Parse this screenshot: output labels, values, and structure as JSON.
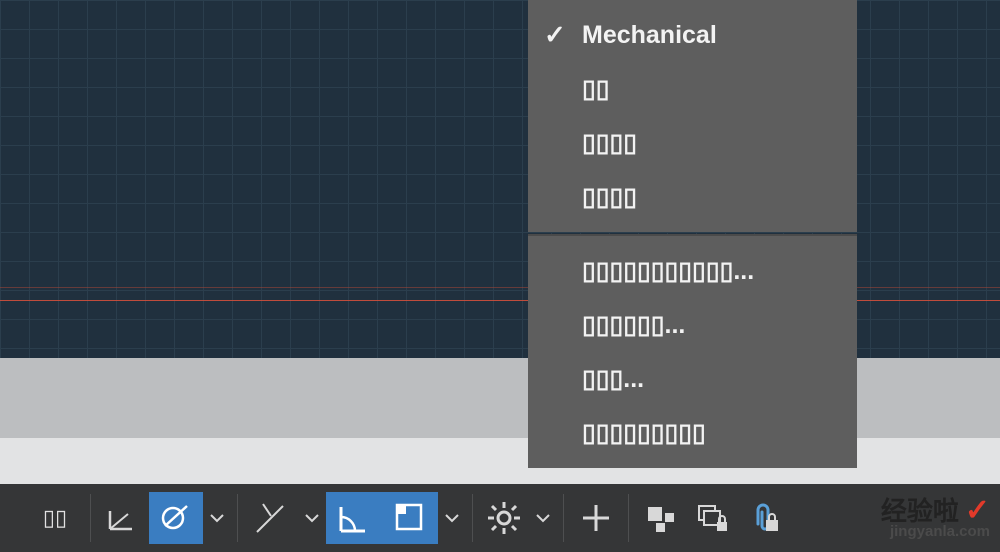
{
  "menu": {
    "block1": [
      {
        "label": "Mechanical",
        "checked": true
      },
      {
        "label": "▯▯",
        "checked": false
      },
      {
        "label": "▯▯▯▯",
        "checked": false
      },
      {
        "label": "▯▯▯▯",
        "checked": false
      }
    ],
    "block2": [
      {
        "label": "▯▯▯▯▯▯▯▯▯▯▯..."
      },
      {
        "label": "▯▯▯▯▯▯..."
      },
      {
        "label": "▯▯▯..."
      },
      {
        "label": "▯▯▯▯▯▯▯▯▯"
      }
    ]
  },
  "statusbar": {
    "model_label": "▯▯",
    "buttons": {
      "snap": {
        "active": false,
        "icon": "angle-icon"
      },
      "osnap": {
        "active": true,
        "icon": "osnap-icon"
      },
      "otrack": {
        "active": false,
        "icon": "otrack-icon"
      },
      "polar": {
        "active": true,
        "icon": "polar-icon"
      },
      "lwt": {
        "active": true,
        "icon": "lineweight-icon"
      },
      "gear": {
        "icon": "gear-icon"
      },
      "plus": {
        "icon": "plus-icon"
      },
      "layout": {
        "icon": "layout-icon"
      },
      "lock": {
        "icon": "layer-lock-icon"
      },
      "attach": {
        "icon": "attach-icon"
      }
    }
  },
  "watermark": {
    "name": "经验啦",
    "mark": "✓",
    "domain": "jingyanla.com"
  },
  "colors": {
    "active_blue": "#3a7dc1",
    "menu_bg": "#5e5e5e",
    "statusbar_bg": "#353637",
    "canvas_bg": "#20303e"
  }
}
